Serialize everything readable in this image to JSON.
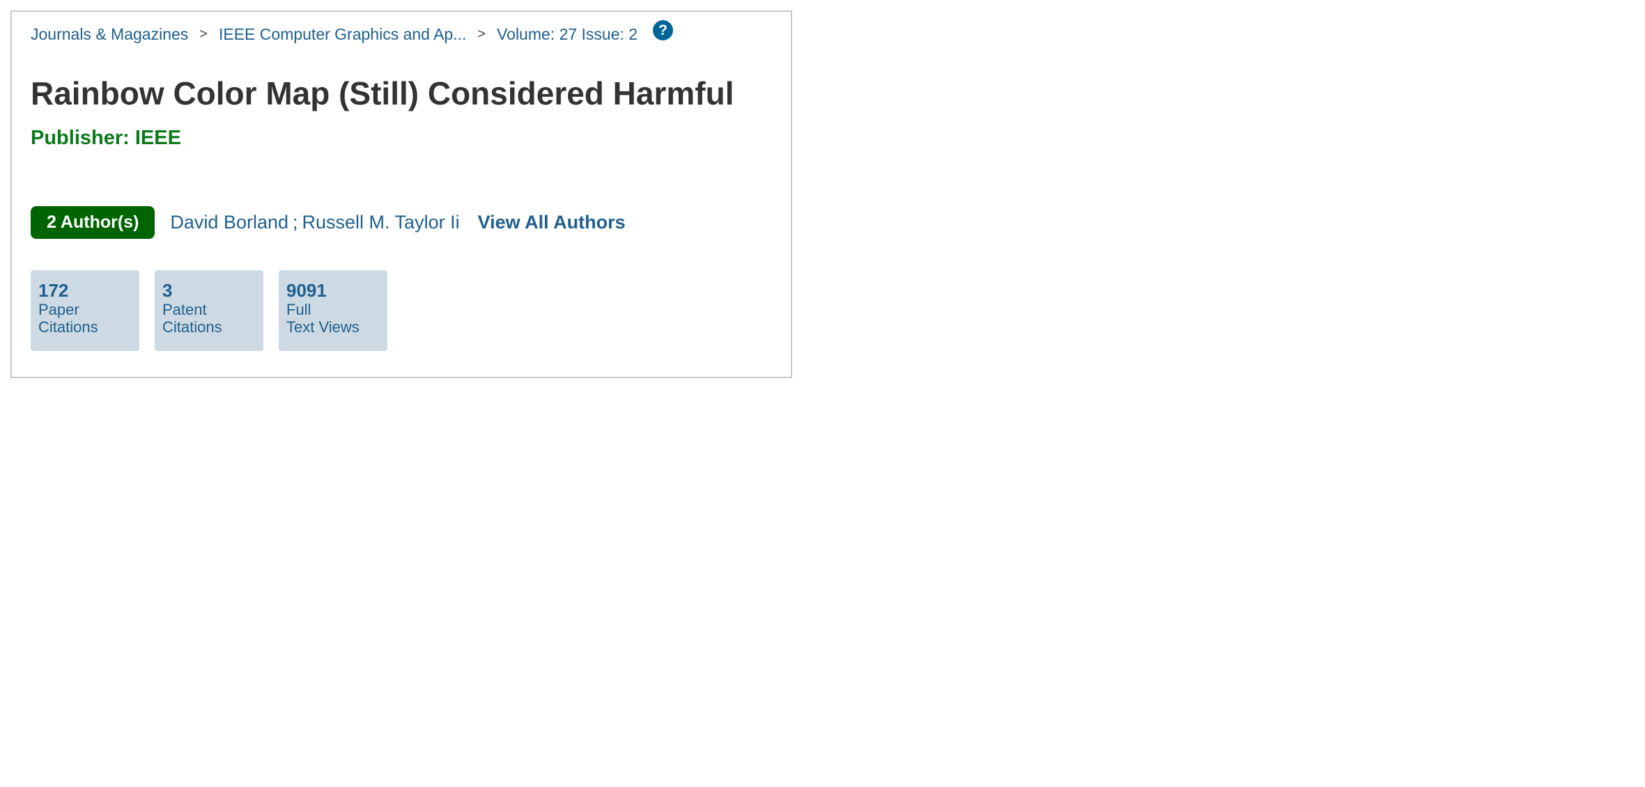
{
  "breadcrumb": {
    "items": [
      "Journals & Magazines",
      "IEEE Computer Graphics and Ap...",
      "Volume: 27 Issue: 2"
    ],
    "separator": ">",
    "help_icon": "?"
  },
  "article": {
    "title": "Rainbow Color Map (Still) Considered Harmful",
    "publisher": "Publisher: IEEE"
  },
  "authors": {
    "badge": "2 Author(s)",
    "names": [
      "David Borland",
      "Russell M. Taylor Ii"
    ],
    "separator": ";",
    "view_all": "View All Authors"
  },
  "metrics": [
    {
      "value": "172",
      "label_line1": "Paper",
      "label_line2": "Citations"
    },
    {
      "value": "3",
      "label_line1": "Patent",
      "label_line2": "Citations"
    },
    {
      "value": "9091",
      "label_line1": "Full",
      "label_line2": "Text Views"
    }
  ],
  "colors": {
    "link": "#1f5f8f",
    "publisher": "#0b7a1a",
    "badge_bg": "#006400",
    "metric_bg": "#cddae3",
    "help_icon_bg": "#006699",
    "title": "#333333"
  }
}
